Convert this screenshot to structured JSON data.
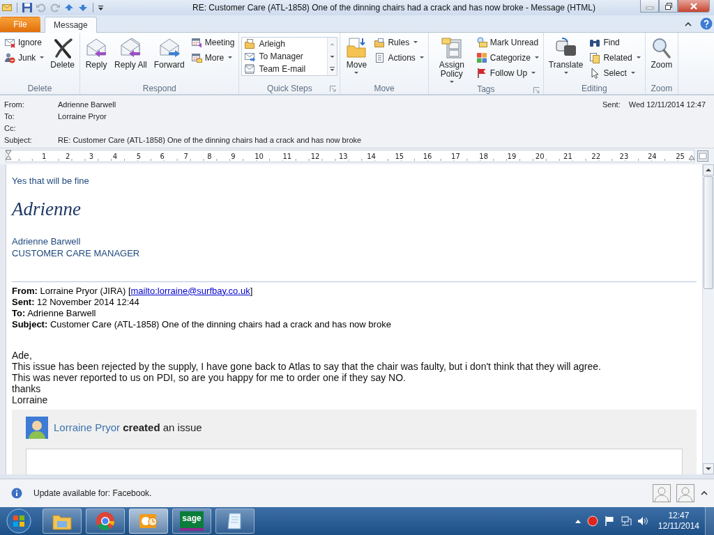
{
  "window": {
    "title": "RE: Customer Care (ATL-1858) One of the dinning chairs had a crack and has now broke  -  Message (HTML)"
  },
  "tabs": [
    {
      "label": "File",
      "kind": "file",
      "selected": false
    },
    {
      "label": "Message",
      "kind": "tab",
      "selected": true
    }
  ],
  "ribbon": {
    "groups": [
      {
        "label": "Delete",
        "launcher": false,
        "columns": [
          {
            "kind": "stack",
            "items": [
              {
                "label": "Ignore",
                "dropdown": false
              },
              {
                "label": "Junk",
                "dropdown": true
              }
            ]
          },
          {
            "kind": "large",
            "items": [
              {
                "label": "Delete",
                "dropdown": false
              }
            ]
          }
        ]
      },
      {
        "label": "Respond",
        "launcher": false,
        "columns": [
          {
            "kind": "large",
            "items": [
              {
                "label": "Reply",
                "dropdown": false
              }
            ]
          },
          {
            "kind": "large",
            "items": [
              {
                "label": "Reply All",
                "dropdown": false
              }
            ]
          },
          {
            "kind": "large",
            "items": [
              {
                "label": "Forward",
                "dropdown": false
              }
            ]
          },
          {
            "kind": "stack",
            "items": [
              {
                "label": "Meeting",
                "dropdown": false
              },
              {
                "label": "More",
                "dropdown": true
              }
            ]
          }
        ]
      },
      {
        "label": "Quick Steps",
        "launcher": true,
        "columns": [
          {
            "kind": "gallery",
            "items": [
              {
                "label": "Arleigh"
              },
              {
                "label": "To Manager"
              },
              {
                "label": "Team E-mail"
              }
            ]
          }
        ]
      },
      {
        "label": "Move",
        "launcher": false,
        "columns": [
          {
            "kind": "large",
            "items": [
              {
                "label": "Move",
                "dropdown": true
              }
            ]
          },
          {
            "kind": "stack",
            "items": [
              {
                "label": "Rules",
                "dropdown": true
              },
              {
                "label": "Actions",
                "dropdown": true
              }
            ]
          }
        ]
      },
      {
        "label": "Tags",
        "launcher": true,
        "columns": [
          {
            "kind": "large",
            "items": [
              {
                "label": "Assign Policy",
                "dropdown": true
              }
            ]
          },
          {
            "kind": "stack",
            "items": [
              {
                "label": "Mark Unread",
                "dropdown": false
              },
              {
                "label": "Categorize",
                "dropdown": true
              },
              {
                "label": "Follow Up",
                "dropdown": true
              }
            ]
          }
        ]
      },
      {
        "label": "Editing",
        "launcher": false,
        "columns": [
          {
            "kind": "large",
            "items": [
              {
                "label": "Translate",
                "dropdown": true
              }
            ]
          },
          {
            "kind": "stack",
            "items": [
              {
                "label": "Find",
                "dropdown": false
              },
              {
                "label": "Related",
                "dropdown": true
              },
              {
                "label": "Select",
                "dropdown": true
              }
            ]
          }
        ]
      },
      {
        "label": "Zoom",
        "launcher": false,
        "columns": [
          {
            "kind": "large",
            "items": [
              {
                "label": "Zoom",
                "dropdown": false
              }
            ]
          }
        ]
      }
    ]
  },
  "header": {
    "fields": [
      {
        "label": "From:",
        "value": "Adrienne Barwell"
      },
      {
        "label": "To:",
        "value": "Lorraine Pryor"
      },
      {
        "label": "Cc:"
      },
      {
        "label": "Subject:",
        "value": "RE: Customer Care (ATL-1858) One of the dinning chairs had a crack and has now broke"
      }
    ],
    "sent": {
      "label": "Sent:",
      "value": "Wed 12/11/2014 12:47"
    }
  },
  "ruler": {
    "marks": [
      "1",
      "2",
      "3",
      "4",
      "5",
      "6",
      "7",
      "8",
      "9",
      "10",
      "11",
      "12",
      "13",
      "14",
      "15",
      "16",
      "17",
      "18",
      "19",
      "20",
      "21",
      "22",
      "23",
      "24",
      "25"
    ]
  },
  "body": {
    "reply": "Yes that will be fine",
    "signature_script": "Adrienne",
    "signature_name": "Adrienne Barwell",
    "signature_title": "CUSTOMER CARE MANAGER",
    "quoted_header": [
      {
        "label": "From:",
        "value": "Lorraine Pryor (JIRA) [",
        "link": "mailto:lorraine@surfbay.co.uk",
        "after": "]"
      },
      {
        "label": "Sent:",
        "value": "12 November 2014 12:44"
      },
      {
        "label": "To:",
        "value": "Adrienne Barwell"
      },
      {
        "label": "Subject:",
        "value": "Customer Care (ATL-1858) One of the dinning chairs had a crack and has now broke"
      }
    ],
    "message": [
      "Ade,",
      "This issue has been rejected by the supply, I have gone back to Atlas to say that the chair was faulty, but i don't think that they will agree.",
      "This was never reported to us on PDI, so are you happy for me to order one if they say NO.",
      "thanks",
      "Lorraine"
    ],
    "jira": {
      "actor": "Lorraine Pryor",
      "action": "**created** an issue"
    }
  },
  "info_bar": {
    "text": "Update available for: Facebook."
  },
  "taskbar": {
    "apps": [
      {
        "kind": "folder",
        "active": false
      },
      {
        "kind": "browser",
        "active": false
      },
      {
        "kind": "mail",
        "active": true
      },
      {
        "kind": "sage",
        "label": "sage",
        "active": false
      },
      {
        "kind": "notepad",
        "active": false
      }
    ],
    "time": "12:47",
    "date": "12/11/2014"
  }
}
